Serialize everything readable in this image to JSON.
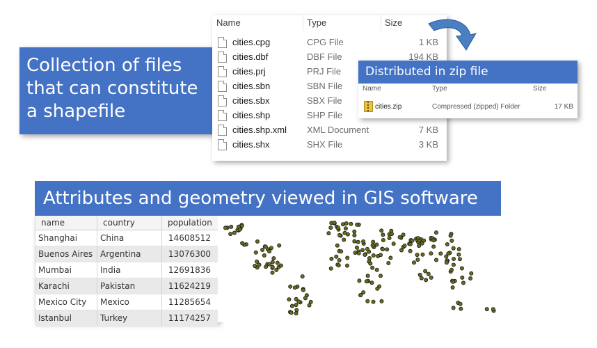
{
  "banner_files": {
    "line1": "Collection of files",
    "line2": "that can constitute",
    "line3": "a shapefile"
  },
  "explorer": {
    "headers": {
      "name": "Name",
      "type": "Type",
      "size": "Size"
    },
    "files": [
      {
        "name": "cities.cpg",
        "type": "CPG File",
        "size": "1 KB"
      },
      {
        "name": "cities.dbf",
        "type": "DBF File",
        "size": "194 KB"
      },
      {
        "name": "cities.prj",
        "type": "PRJ File",
        "size": ""
      },
      {
        "name": "cities.sbn",
        "type": "SBN File",
        "size": ""
      },
      {
        "name": "cities.sbx",
        "type": "SBX File",
        "size": ""
      },
      {
        "name": "cities.shp",
        "type": "SHP File",
        "size": ""
      },
      {
        "name": "cities.shp.xml",
        "type": "XML Document",
        "size": "7 KB"
      },
      {
        "name": "cities.shx",
        "type": "SHX File",
        "size": "3 KB"
      }
    ]
  },
  "zip": {
    "title": "Distributed in zip file",
    "headers": {
      "name": "Name",
      "type": "Type",
      "size": "Size"
    },
    "file": {
      "name": "cities.zip",
      "type": "Compressed (zipped) Folder",
      "size": "17 KB"
    }
  },
  "banner_attrs": {
    "text": "Attributes and geometry viewed in GIS software"
  },
  "table": {
    "columns": [
      "name",
      "country",
      "population"
    ],
    "rows": [
      [
        "Shanghai",
        "China",
        "14608512"
      ],
      [
        "Buenos Aires",
        "Argentina",
        "13076300"
      ],
      [
        "Mumbai",
        "India",
        "12691836"
      ],
      [
        "Karachi",
        "Pakistan",
        "11624219"
      ],
      [
        "Mexico City",
        "Mexico",
        "11285654"
      ],
      [
        "Istanbul",
        "Turkey",
        "11174257"
      ]
    ]
  },
  "colors": {
    "banner": "#4472c4",
    "point_fill": "#6b6b1e",
    "arrow": "#4a7fc1"
  }
}
